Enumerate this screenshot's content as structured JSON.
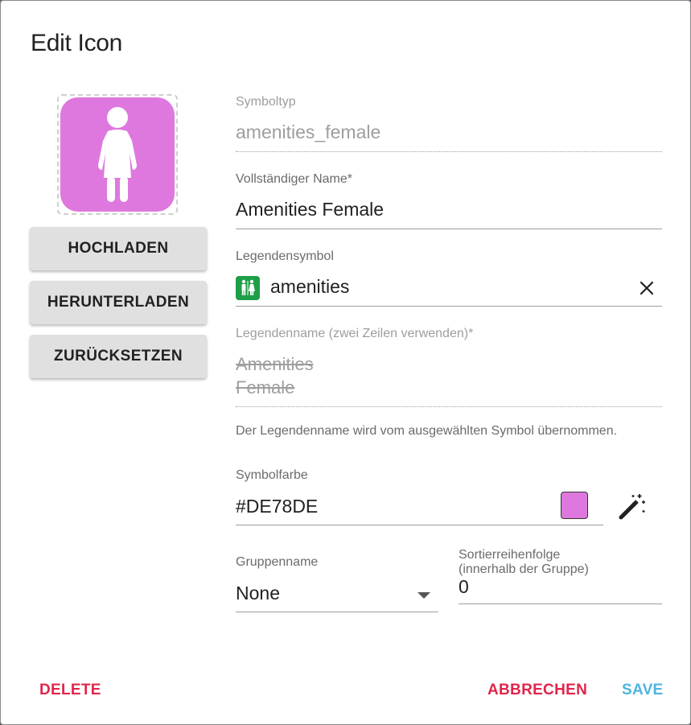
{
  "dialog": {
    "title": "Edit Icon"
  },
  "preview": {
    "icon": "female-person-icon",
    "color": "#DE78DE"
  },
  "buttons": {
    "upload": "HOCHLADEN",
    "download": "HERUNTERLADEN",
    "reset": "ZURÜCKSETZEN"
  },
  "fields": {
    "symbol_type": {
      "label": "Symboltyp",
      "value": "amenities_female"
    },
    "full_name": {
      "label": "Vollständiger Name*",
      "value": "Amenities Female"
    },
    "legend_symbol": {
      "label": "Legendensymbol",
      "value": "amenities",
      "icon": "restroom-icon",
      "icon_color": "#1E9E47"
    },
    "legend_name": {
      "label": "Legendenname (zwei Zeilen verwenden)*",
      "line1": "Amenities",
      "line2": "Female"
    },
    "legend_hint": "Der Legendenname wird vom ausgewählten Symbol übernommen.",
    "symbol_color": {
      "label": "Symbolfarbe",
      "value": "#DE78DE"
    },
    "group_name": {
      "label": "Gruppenname",
      "value": "None"
    },
    "sort_order": {
      "label_line1": "Sortierreihenfolge",
      "label_line2": "(innerhalb der Gruppe)",
      "value": "0"
    }
  },
  "footer": {
    "delete": "DELETE",
    "cancel": "ABBRECHEN",
    "save": "SAVE",
    "delete_color": "#E0254B",
    "save_color": "#4FB4E0"
  }
}
